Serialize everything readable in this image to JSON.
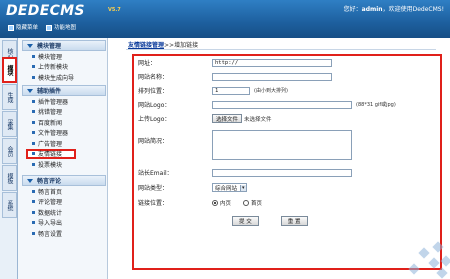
{
  "header": {
    "logo": "DEDECMS",
    "version": "V5.7",
    "welcome_prefix": "您好：",
    "username": "admin",
    "welcome_suffix": "，欢迎使用DedeCMS!",
    "links": [
      {
        "label": "隐藏菜单"
      },
      {
        "label": "功能地图"
      }
    ]
  },
  "vtabs": [
    {
      "label": "核心",
      "active": false
    },
    {
      "label": "模块",
      "active": true
    },
    {
      "label": "生成",
      "active": false
    },
    {
      "label": "采集",
      "active": false
    },
    {
      "label": "会员",
      "active": false
    },
    {
      "label": "模板",
      "active": false
    },
    {
      "label": "系统",
      "active": false
    }
  ],
  "menu": {
    "sections": [
      {
        "title": "模块管理",
        "items": [
          {
            "label": "模块管理",
            "active": false
          },
          {
            "label": "上传新模块",
            "active": false
          },
          {
            "label": "模块生成向导",
            "active": false
          }
        ]
      },
      {
        "title": "辅助插件",
        "items": [
          {
            "label": "插件管理器",
            "active": false
          },
          {
            "label": "挑错管理",
            "active": false
          },
          {
            "label": "百度新闻",
            "active": false
          },
          {
            "label": "文件管理器",
            "active": false
          },
          {
            "label": "广告管理",
            "active": false
          },
          {
            "label": "友情链接",
            "active": true
          },
          {
            "label": "投票模块",
            "active": false
          }
        ]
      },
      {
        "title": "畅言评论",
        "items": [
          {
            "label": "畅言首页",
            "active": false
          },
          {
            "label": "评论管理",
            "active": false
          },
          {
            "label": "数据统计",
            "active": false
          },
          {
            "label": "导入导出",
            "active": false
          },
          {
            "label": "畅言设置",
            "active": false
          }
        ]
      }
    ]
  },
  "main": {
    "breadcrumb_link": "友情链接管理",
    "breadcrumb_sep": ">>",
    "breadcrumb_current": "增加链接",
    "form": {
      "url_label": "网址：",
      "url_value": "http://",
      "site_name_label": "网站名称：",
      "order_label": "排列位置：",
      "order_value": "1",
      "order_hint": "(由小到大排列)",
      "logo_label": "网站Logo：",
      "logo_hint": "(88*31 gif或jpg)",
      "upload_logo_label": "上传Logo：",
      "file_button": "选择文件",
      "file_none": "未选择文件",
      "desc_label": "网站简况：",
      "email_label": "站长Email：",
      "type_label": "网站类型：",
      "type_value": "综合网站",
      "position_label": "链接位置：",
      "position_options": [
        "内页",
        "首页"
      ],
      "position_selected": "内页",
      "submit_button": "提 交",
      "reset_button": "重 置"
    }
  }
}
